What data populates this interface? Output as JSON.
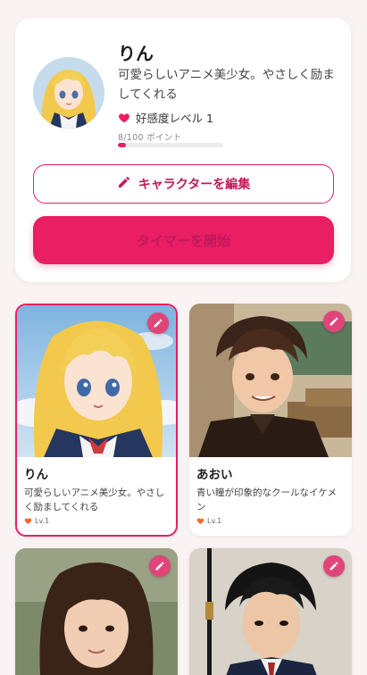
{
  "profile": {
    "name": "りん",
    "description": "可愛らしいアニメ美少女。やさしく励ましてくれる",
    "affection_label": "好感度レベル 1",
    "points_text": "8/100 ポイント",
    "progress": 0.08,
    "edit_button": "キャラクターを編集",
    "timer_button": "タイマーを開始"
  },
  "characters": [
    {
      "name": "りん",
      "description": "可愛らしいアニメ美少女。やさしく励ましてくれる",
      "level": "Lv.1",
      "selected": true
    },
    {
      "name": "あおい",
      "description": "青い瞳が印象的なクールなイケメン",
      "level": "Lv.1",
      "selected": false
    },
    {
      "name": "",
      "description": "",
      "level": "",
      "selected": false
    },
    {
      "name": "",
      "description": "",
      "level": "",
      "selected": false
    }
  ],
  "colors": {
    "accent": "#e91e63",
    "background": "#faf3f4"
  },
  "icons": {
    "heart": "heart-icon",
    "edit": "pencil-icon"
  }
}
